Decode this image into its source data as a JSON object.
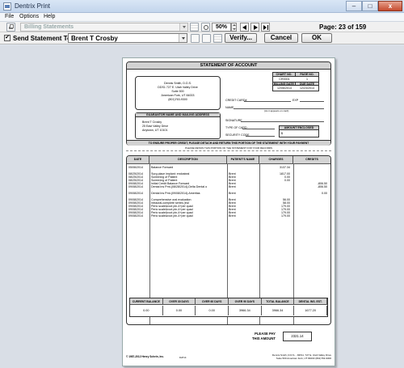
{
  "window": {
    "title": "Dentrix Print",
    "min_glyph": "–",
    "max_glyph": "□",
    "close_glyph": "x"
  },
  "menu": [
    "File",
    "Options",
    "Help"
  ],
  "toolbar": {
    "report_type": "Billing Statements",
    "zoom": "50%",
    "page_indicator": "Page: 23 of 159"
  },
  "send_bar": {
    "checked_glyph": "✔",
    "label": "Send Statement To:",
    "patient": "Brent T Crosby",
    "verify_label": "Verify...",
    "cancel_label": "Cancel",
    "ok_label": "OK"
  },
  "statement": {
    "title": "STATEMENT OF ACCOUNT",
    "practice": [
      "Dennis Smith, D.D.S.",
      "DDS1 727 E. Utah Valley Drive",
      "Suite 500",
      "American Fork, UT 84003",
      "(801)763-9300"
    ],
    "chart_no_label": "CHART NO.",
    "chart_no": "CR0001",
    "page_no_label": "PAGE NO.",
    "page_no": "1",
    "billing_date_label": "BILLING DATE",
    "billing_date": "12/06/2014",
    "due_date_label": "DUE DATE",
    "due_date": "12/23/2014",
    "card_labels": [
      "CREDIT CARD#",
      "EXP",
      "NAME",
      "SIGNATURE",
      "TYPE OF CARD",
      "SECURITY CODE"
    ],
    "card_note": "(As it appears on card)",
    "amount_enclosed_label": "AMOUNT ENCLOSED",
    "amount_dollar": "$",
    "guarantor_label": "GUARANTOR NAME AND MAILING ADDRESS",
    "guarantor": [
      "Brent T Crosby",
      "25 East Valley Drive",
      "Anytown, UT          10101"
    ],
    "remit_banner": "TO ENSURE PROPER CREDIT, PLEASE DETACH AND RETURN THIS PORTION OF THE STATEMENT WITH YOUR PAYMENT",
    "retain_note": "PLEASE RETAIN THIS PORTION OF THE STATEMENT FOR YOUR RECORDS",
    "columns": [
      "DATE",
      "DESCRIPTION",
      "PATIENT'S NAME",
      "CHARGES",
      "CREDITS"
    ],
    "rows": [
      {
        "date": "05/06/2014",
        "desc": "Balance Forward",
        "pat": "",
        "chg": "3137.34",
        "crd": "",
        "gap": 1
      },
      {
        "date": "08/25/2014",
        "desc": "Surg place implant: endosteal",
        "pat": "Brent",
        "chg": "1817.00",
        "crd": "",
        "gap": 0
      },
      {
        "date": "08/25/2014",
        "desc": "Screening of Patient",
        "pat": "Brent",
        "chg": "0.00",
        "crd": "",
        "gap": 0
      },
      {
        "date": "08/25/2014",
        "desc": "Screening of Patient",
        "pat": "Brent",
        "chg": "0.00",
        "crd": "",
        "gap": 0
      },
      {
        "date": "09/08/2014",
        "desc": "Initial Credit Balance Forward",
        "pat": "Brent",
        "chg": "",
        "crd": "-806.50",
        "gap": 0
      },
      {
        "date": "09/08/2014",
        "desc": "Dental Ins Pmt-(08/28/2014)-Delta Dental o",
        "pat": "Brent",
        "chg": "",
        "crd": "-806.50",
        "gap": 1
      },
      {
        "date": "09/08/2014",
        "desc": "Dental Ins Pmt-(09/08/2014)-Ameritas",
        "pat": "Brent",
        "chg": "",
        "crd": "0.00",
        "gap": 1
      },
      {
        "date": "09/08/2014",
        "desc": "Comprehensive oral evaluation",
        "pat": "Brent",
        "chg": "56.00",
        "crd": "",
        "gap": 0
      },
      {
        "date": "09/08/2014",
        "desc": "Intraoral-complete series (incl",
        "pat": "Brent",
        "chg": "58.00",
        "crd": "",
        "gap": 0
      },
      {
        "date": "09/08/2014",
        "desc": "Perio scale&root pln-4+per quad",
        "pat": "Brent",
        "chg": "179.00",
        "crd": "",
        "gap": 0
      },
      {
        "date": "09/08/2014",
        "desc": "Perio scale&root pln-4+per quad",
        "pat": "Brent",
        "chg": "179.00",
        "crd": "",
        "gap": 0
      },
      {
        "date": "09/08/2014",
        "desc": "Perio scale&root pln-4+per quad",
        "pat": "Brent",
        "chg": "179.00",
        "crd": "",
        "gap": 0
      },
      {
        "date": "09/08/2014",
        "desc": "Perio scale&root pln-4+per quad",
        "pat": "Brent",
        "chg": "179.00",
        "crd": "",
        "gap": 0
      }
    ],
    "aging_labels": [
      "CURRENT BALANCE",
      "OVER 30 DAYS",
      "OVER 60 DAYS",
      "OVER 90 DAYS",
      "TOTAL BALANCE",
      "DENTAL INS. EST."
    ],
    "aging_values": [
      "0.00",
      "0.00",
      "0.00",
      "3966.34",
      "3966.34",
      "1677.20"
    ],
    "please_pay": "PLEASE PAY",
    "this_amount": "THIS AMOUNT",
    "pay_amount": "2321.14",
    "copyright": "© 1987-2012 Henry Schein, Inc.",
    "form_id": "DxP14",
    "footer_addr": [
      "Dennis Smith, D.D.S. - DDS1, 727 E. Utah Valley Drive",
      "Suite 500 American Fork, UT 84003 (801)763-9300"
    ]
  }
}
